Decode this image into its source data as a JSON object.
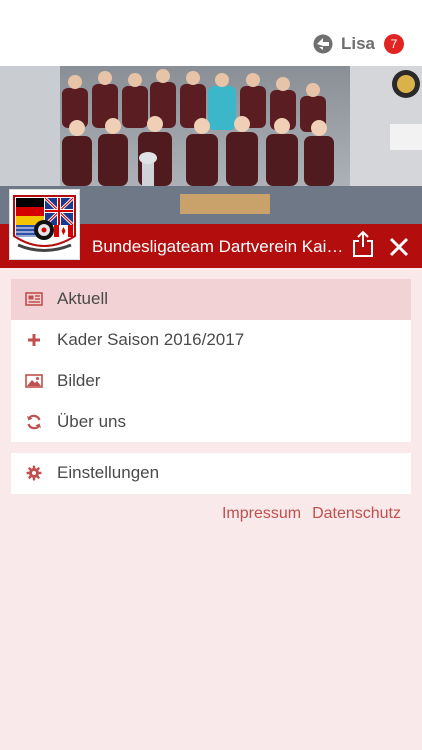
{
  "user": {
    "name": "Lisa",
    "badge_count": "7",
    "icon": "group-switch-icon"
  },
  "hero": {
    "image": "team-group-photo"
  },
  "header": {
    "title": "Bundesligateam Dartverein Kaiserslautern",
    "share_icon": "share-icon",
    "close_icon": "close-icon",
    "logo": "club-logo"
  },
  "menu": {
    "items": [
      {
        "label": "Aktuell",
        "icon": "newspaper-icon",
        "active": true
      },
      {
        "label": "Kader Saison 2016/2017",
        "icon": "plus-icon",
        "active": false
      },
      {
        "label": "Bilder",
        "icon": "image-icon",
        "active": false
      },
      {
        "label": "Über uns",
        "icon": "refresh-icon",
        "active": false
      }
    ],
    "settings": {
      "label": "Einstellungen",
      "icon": "gear-icon"
    }
  },
  "footer_links": {
    "impressum": "Impressum",
    "datenschutz": "Datenschutz"
  },
  "colors": {
    "accent": "#b30d0d",
    "icon": "#c0504d",
    "background": "#f9e9ea",
    "active": "#f2d2d4"
  }
}
